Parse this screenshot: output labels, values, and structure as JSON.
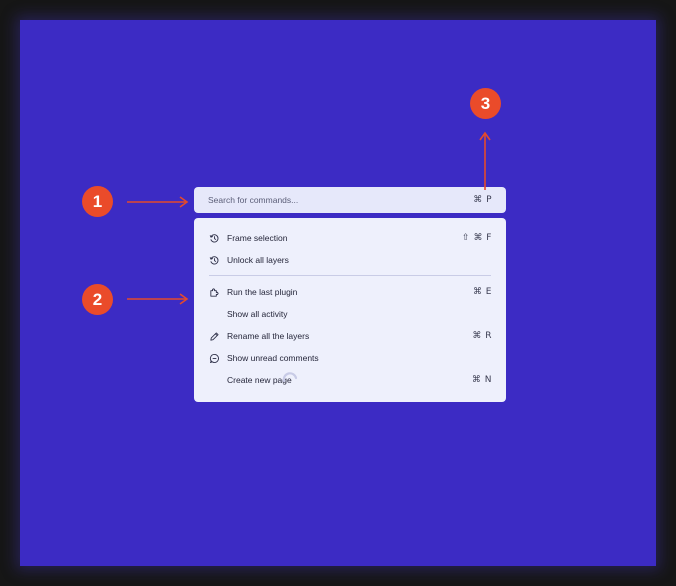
{
  "search": {
    "placeholder": "Search for commands...",
    "shortcut": "⌘ P"
  },
  "menu": {
    "items": [
      {
        "label": "Frame selection",
        "icon": "history-icon",
        "shortcut": "⇧ ⌘ F"
      },
      {
        "label": "Unlock all layers",
        "icon": "history-icon",
        "shortcut": ""
      },
      {
        "label": "Run the last plugin",
        "icon": "plugin-icon",
        "shortcut": "⌘ E"
      },
      {
        "label": "Show all activity",
        "icon": "",
        "shortcut": ""
      },
      {
        "label": "Rename all the layers",
        "icon": "pencil-icon",
        "shortcut": "⌘ R"
      },
      {
        "label": "Show unread comments",
        "icon": "comment-icon",
        "shortcut": ""
      },
      {
        "label": "Create new page",
        "icon": "",
        "shortcut": "⌘ N"
      }
    ]
  },
  "annotations": {
    "badge_1": "1",
    "badge_2": "2",
    "badge_3": "3"
  },
  "colors": {
    "canvas": "#3c2bc4",
    "accent": "#ea4b2a",
    "search_bg": "#e6e8fa",
    "menu_bg": "#eef0fc"
  }
}
